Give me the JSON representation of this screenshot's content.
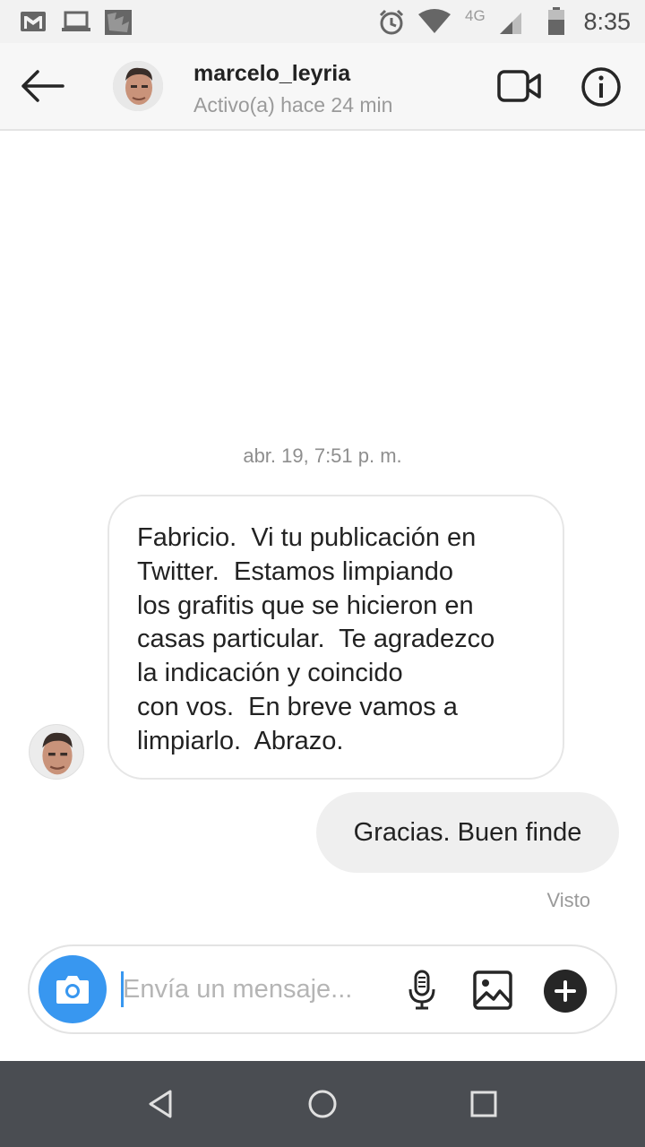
{
  "status_bar": {
    "time": "8:35",
    "network": "4G",
    "icons": [
      "gmail-icon",
      "laptop-icon",
      "app-icon",
      "alarm-icon",
      "wifi-icon",
      "signal-icon",
      "battery-icon"
    ]
  },
  "header": {
    "username": "marcelo_leyria",
    "status": "Activo(a) hace 24 min",
    "icons": [
      "back-arrow-icon",
      "video-call-icon",
      "info-icon"
    ]
  },
  "conversation": {
    "timestamp": "abr. 19, 7:51 p. m.",
    "incoming": {
      "lines": [
        "Fabricio.  Vi tu publicación en",
        "Twitter.  Estamos limpiando",
        "los grafitis que se hicieron en",
        "casas particular.  Te agradezco",
        "la indicación y coincido",
        "con vos.  En breve vamos a",
        "limpiarlo.  Abrazo."
      ]
    },
    "outgoing": {
      "text": "Gracias. Buen finde"
    },
    "seen_label": "Visto"
  },
  "composer": {
    "placeholder": "Envía un mensaje...",
    "value": "",
    "icons": [
      "camera-icon",
      "microphone-icon",
      "gallery-icon",
      "plus-icon"
    ]
  },
  "nav_bar": {
    "icons": [
      "nav-back-icon",
      "nav-home-icon",
      "nav-recents-icon"
    ]
  },
  "colors": {
    "accent": "#3897f0",
    "bubble_out": "#efefef",
    "bubble_border": "#e6e6e6",
    "nav_bar": "#4a4d52"
  }
}
